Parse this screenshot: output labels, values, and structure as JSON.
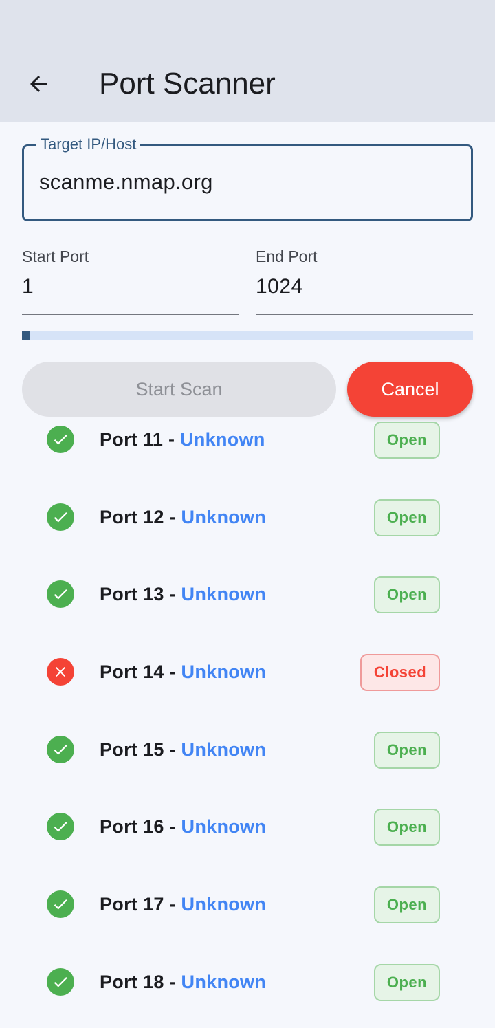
{
  "app_bar": {
    "title": "Port Scanner",
    "back_icon": "arrow-back-icon"
  },
  "form": {
    "target": {
      "label": "Target IP/Host",
      "value": "scanme.nmap.org"
    },
    "start_port": {
      "label": "Start Port",
      "value": "1"
    },
    "end_port": {
      "label": "End Port",
      "value": "1024"
    },
    "progress_percent": 1.7
  },
  "buttons": {
    "start_label": "Start Scan",
    "cancel_label": "Cancel"
  },
  "colors": {
    "primary": "#33597f",
    "open": "#4caf50",
    "closed": "#f44336",
    "service_link": "#4285f4"
  },
  "results": [
    {
      "port_text": "Port 11 - ",
      "service": "Unknown",
      "status": "open",
      "badge": "Open"
    },
    {
      "port_text": "Port 12 - ",
      "service": "Unknown",
      "status": "open",
      "badge": "Open"
    },
    {
      "port_text": "Port 13 - ",
      "service": "Unknown",
      "status": "open",
      "badge": "Open"
    },
    {
      "port_text": "Port 14 - ",
      "service": "Unknown",
      "status": "closed",
      "badge": "Closed"
    },
    {
      "port_text": "Port 15 - ",
      "service": "Unknown",
      "status": "open",
      "badge": "Open"
    },
    {
      "port_text": "Port 16 - ",
      "service": "Unknown",
      "status": "open",
      "badge": "Open"
    },
    {
      "port_text": "Port 17 - ",
      "service": "Unknown",
      "status": "open",
      "badge": "Open"
    },
    {
      "port_text": "Port 18 - ",
      "service": "Unknown",
      "status": "open",
      "badge": "Open"
    }
  ]
}
